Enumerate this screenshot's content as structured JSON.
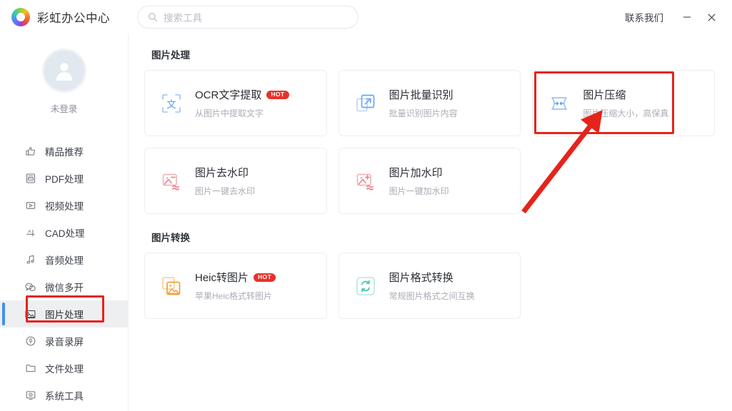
{
  "titlebar": {
    "brand_name": "彩虹办公中心",
    "logo_icon": "rainbow-circle-logo",
    "search": {
      "placeholder": "搜索工具",
      "value": "",
      "icon": "search-icon"
    },
    "contact_label": "联系我们",
    "minimize_icon": "minimize-icon",
    "close_icon": "close-icon"
  },
  "sidebar": {
    "avatar_icon": "user-avatar-icon",
    "login_state": "未登录",
    "items": [
      {
        "label": "精品推荐",
        "icon": "thumbs-up-icon",
        "active": false
      },
      {
        "label": "PDF处理",
        "icon": "pdf-file-icon",
        "active": false
      },
      {
        "label": "视频处理",
        "icon": "video-play-icon",
        "active": false
      },
      {
        "label": "CAD处理",
        "icon": "cad-ruler-icon",
        "active": false
      },
      {
        "label": "音频处理",
        "icon": "music-note-icon",
        "active": false
      },
      {
        "label": "微信多开",
        "icon": "wechat-icon",
        "active": false
      },
      {
        "label": "图片处理",
        "icon": "image-picture-icon",
        "active": true
      },
      {
        "label": "录音录屏",
        "icon": "microphone-icon",
        "active": false
      },
      {
        "label": "文件处理",
        "icon": "folder-icon",
        "active": false
      },
      {
        "label": "系统工具",
        "icon": "monitor-gear-icon",
        "active": false
      }
    ]
  },
  "main": {
    "sections": [
      {
        "title": "图片处理",
        "cards": [
          {
            "title": "OCR文字提取",
            "desc": "从图片中提取文字",
            "badge": "HOT",
            "icon": "ocr-scan-text-icon",
            "color": "#5b9bf0"
          },
          {
            "title": "图片批量识别",
            "desc": "批量识别图片内容",
            "badge": "",
            "icon": "batch-recognize-icon",
            "color": "#5b9bf0"
          },
          {
            "title": "图片压缩",
            "desc": "图片压缩大小，高保真",
            "badge": "",
            "icon": "compress-icon",
            "color": "#5b9bf0"
          },
          {
            "title": "图片去水印",
            "desc": "图片一键去水印",
            "badge": "",
            "icon": "remove-watermark-icon",
            "color": "#ef8f97"
          },
          {
            "title": "图片加水印",
            "desc": "图片一键加水印",
            "badge": "",
            "icon": "add-watermark-icon",
            "color": "#ef8f97"
          }
        ]
      },
      {
        "title": "图片转换",
        "cards": [
          {
            "title": "Heic转图片",
            "desc": "苹果Heic格式转图片",
            "badge": "HOT",
            "icon": "heic-convert-icon",
            "color": "#f0a13a"
          },
          {
            "title": "图片格式转换",
            "desc": "常规图片格式之间互换",
            "badge": "",
            "icon": "format-swap-icon",
            "color": "#3fc6ad"
          }
        ]
      }
    ]
  },
  "annotations": {
    "highlight_color": "#e6231b",
    "sidebar_box_target": "图片处理",
    "card_box_target": "图片压缩",
    "arrow_label": "arrow-pointing-to-图片压缩"
  }
}
